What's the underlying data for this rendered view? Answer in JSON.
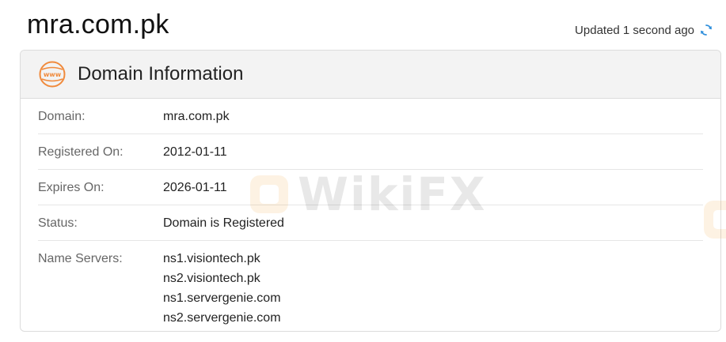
{
  "header": {
    "site": "mra.com.pk",
    "updated_text": "Updated 1 second ago",
    "refresh_icon": "refresh-icon"
  },
  "card": {
    "icon": "www-icon",
    "title": "Domain Information",
    "rows": [
      {
        "label": "Domain:",
        "value": "mra.com.pk"
      },
      {
        "label": "Registered On:",
        "value": "2012-01-11"
      },
      {
        "label": "Expires On:",
        "value": "2026-01-11"
      },
      {
        "label": "Status:",
        "value": "Domain is Registered"
      }
    ],
    "name_servers": {
      "label": "Name Servers:",
      "values": [
        "ns1.visiontech.pk",
        "ns2.visiontech.pk",
        "ns1.servergenie.com",
        "ns2.servergenie.com"
      ]
    }
  },
  "watermark": {
    "text": "WikiFX"
  },
  "colors": {
    "accent_orange": "#f08a3c",
    "refresh_blue": "#2f8fdc",
    "header_bg": "#f3f3f3",
    "border": "#dcdcdc"
  }
}
